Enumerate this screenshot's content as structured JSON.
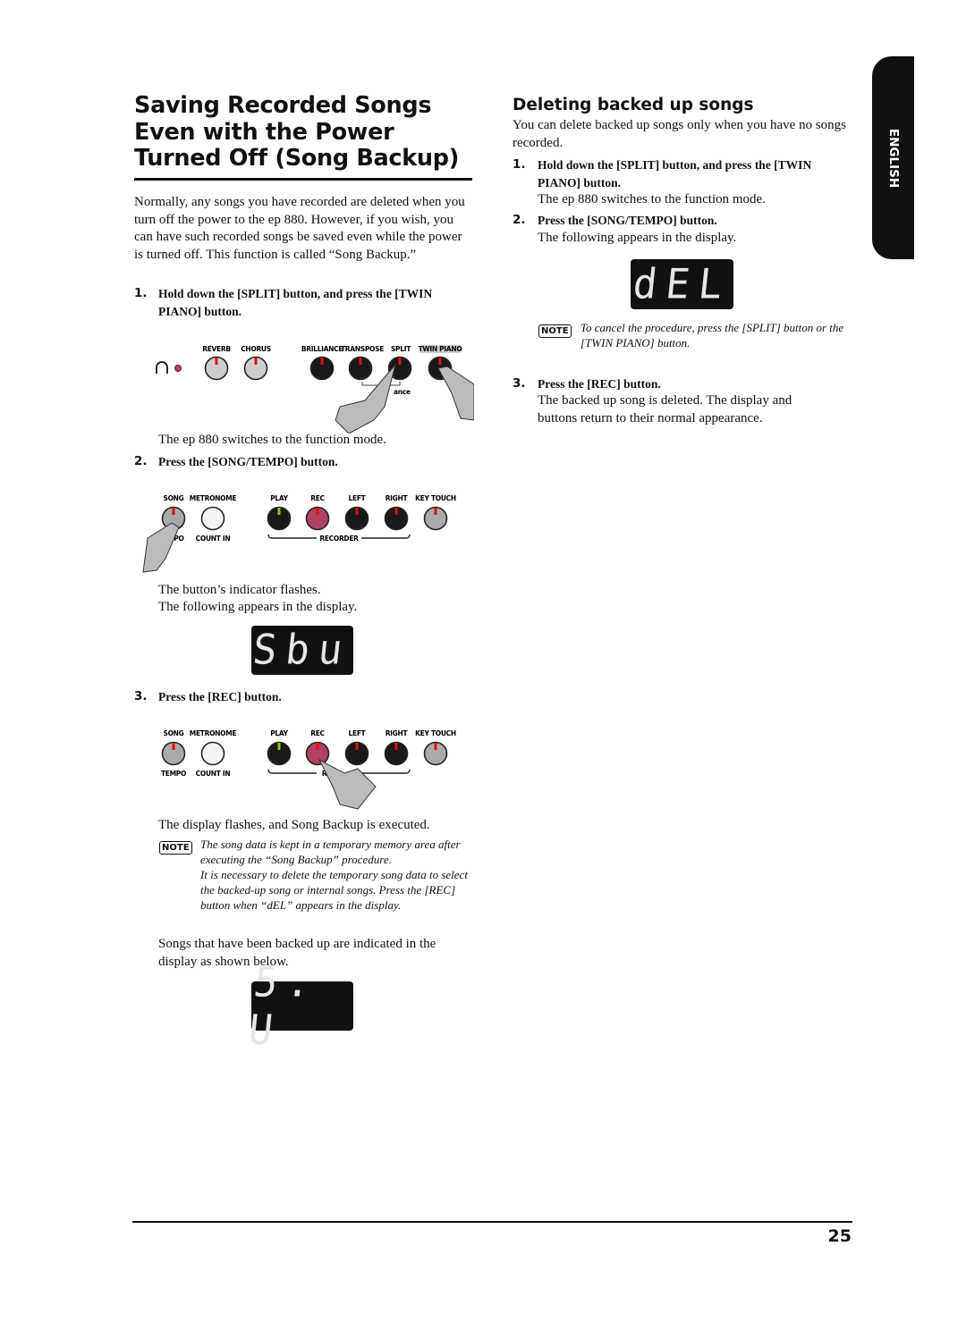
{
  "left": {
    "title": "Saving Recorded Songs Even with the Power Turned Off (Song Backup)",
    "intro": "Normally, any songs you have recorded are deleted when you turn off the power to the ep 880. However, if you wish, you can have such recorded songs be saved even while the power is turned off. This function is called “Song Backup.”",
    "step1": {
      "num": "1.",
      "text": "Hold down the [SPLIT] button, and press the [TWIN PIANO] button."
    },
    "panel1": {
      "labels": [
        "REVERB",
        "CHORUS",
        "BRILLIANCE",
        "TRANSPOSE",
        "SPLIT",
        "TWIN PIANO"
      ],
      "partial_label": "ance"
    },
    "after1": "The ep 880 switches to the function mode.",
    "step2": {
      "num": "2.",
      "text": "Press the [SONG/TEMPO] button."
    },
    "panel2": {
      "labels": [
        "SONG",
        "METRONOME",
        "PLAY",
        "REC",
        "LEFT",
        "RIGHT",
        "KEY TOUCH"
      ],
      "sub_labels": [
        "EMPO",
        "COUNT IN"
      ],
      "group_label": "RECORDER"
    },
    "after2a": "The button’s indicator flashes.",
    "after2b": "The following appears in the display.",
    "display1": "Sbu",
    "step3": {
      "num": "3.",
      "text": "Press the [REC] button."
    },
    "panel3": {
      "labels": [
        "SONG",
        "METRONOME",
        "PLAY",
        "REC",
        "LEFT",
        "RIGHT",
        "KEY TOUCH"
      ],
      "sub_labels": [
        "TEMPO",
        "COUNT IN"
      ],
      "group_label": "RE"
    },
    "after3": "The display flashes, and Song Backup is executed.",
    "note": {
      "badge": "NOTE",
      "line1": "The song data is kept in a temporary memory area after executing the “Song Backup” procedure.",
      "line2": "It is necessary to delete the temporary song data to select the backed-up song or internal songs. Press the [REC] button when “dEL” appears in the display."
    },
    "closing": "Songs that have been backed up are indicated in the display as shown below.",
    "display2": "5. U"
  },
  "right": {
    "heading": "Deleting backed up songs",
    "intro": "You can delete backed up songs only when you have no songs recorded.",
    "step1": {
      "num": "1.",
      "text": "Hold down the [SPLIT] button, and press the [TWIN PIANO] button."
    },
    "after1": "The ep 880 switches to the function mode.",
    "step2": {
      "num": "2.",
      "text": "Press the [SONG/TEMPO] button."
    },
    "after2": "The following appears in the display.",
    "display": "dEL",
    "note": {
      "badge": "NOTE",
      "text": "To cancel the procedure, press the [SPLIT] button or the [TWIN PIANO] button."
    },
    "step3": {
      "num": "3.",
      "text": "Press the [REC] button."
    },
    "after3": "The backed up song is deleted. The display and buttons return to their normal appearance."
  },
  "tab": "ENGLISH",
  "page_number": "25",
  "colors": {
    "led_red": "#e01010",
    "led_green": "#7cd000",
    "rec_button": "#b04060",
    "tab_bg": "#111111"
  }
}
